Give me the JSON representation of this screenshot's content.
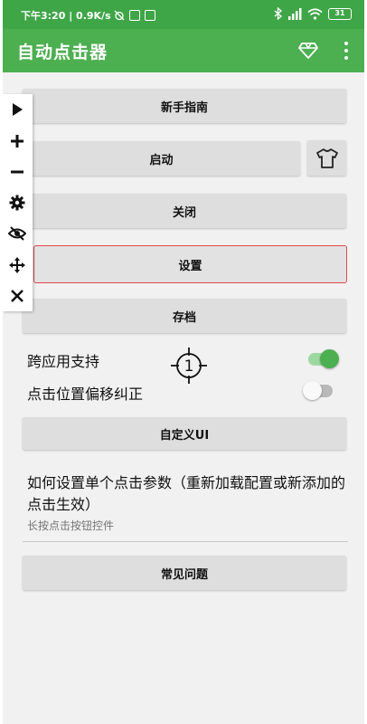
{
  "status_bar": {
    "time_speed": "下午3:20 | 0.9K/s",
    "battery": "31"
  },
  "app_bar": {
    "title": "自动点击器"
  },
  "floating_toolbar": {
    "tools": [
      "play-icon",
      "plus-icon",
      "minus-icon",
      "gear-icon",
      "eye-off-icon",
      "move-icon",
      "close-icon"
    ]
  },
  "buttons": {
    "guide": "新手指南",
    "start": "启动",
    "stop": "关闭",
    "settings": "设置",
    "archive": "存档",
    "custom_ui": "自定义UI",
    "faq": "常见问题"
  },
  "toggles": {
    "cross_app": {
      "label": "跨应用支持",
      "on": true
    },
    "position_offset": {
      "label": "点击位置偏移纠正",
      "on": false
    }
  },
  "crosshair": {
    "number": "1"
  },
  "help": {
    "title": "如何设置单个点击参数（重新加载配置或新添加的点击生效）",
    "subtitle": "长按点击按钮控件"
  },
  "colors": {
    "status_bar": "#3fa648",
    "app_bar": "#4caf50",
    "button": "#dedede",
    "background": "#f1f1f1",
    "selected_outline": "#e0474c",
    "switch_on": "#4caf50"
  }
}
